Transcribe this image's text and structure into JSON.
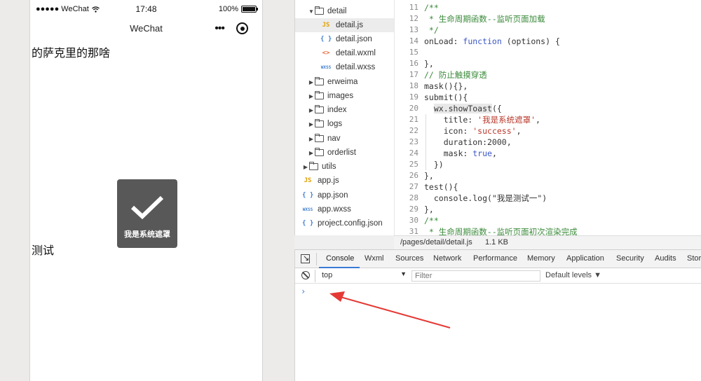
{
  "simulator": {
    "statusbar": {
      "carrier": "●●●●● WeChat",
      "time": "17:48",
      "battery": "100%",
      "battery_level": 1.0
    },
    "navbar": {
      "title": "WeChat",
      "dots": "•••"
    },
    "page": {
      "text1": "的萨克里的那啥",
      "text2": "测试"
    },
    "toast": {
      "title": "我是系统遮罩",
      "icon": "checkmark-icon"
    }
  },
  "file_tree": {
    "items": [
      {
        "label": "detail",
        "type": "folder",
        "open": true,
        "depth": 1
      },
      {
        "label": "detail.js",
        "type": "js",
        "icon_text": "JS",
        "depth": 2,
        "selected": true
      },
      {
        "label": "detail.json",
        "type": "json",
        "icon_text": "{ }",
        "depth": 2
      },
      {
        "label": "detail.wxml",
        "type": "wxml",
        "icon_text": "<>",
        "depth": 2
      },
      {
        "label": "detail.wxss",
        "type": "wxss",
        "icon_text": "WXSS",
        "depth": 2
      },
      {
        "label": "erweima",
        "type": "folder",
        "open": false,
        "depth": 1
      },
      {
        "label": "images",
        "type": "folder",
        "open": false,
        "depth": 1
      },
      {
        "label": "index",
        "type": "folder",
        "open": false,
        "depth": 1
      },
      {
        "label": "logs",
        "type": "folder",
        "open": false,
        "depth": 1
      },
      {
        "label": "nav",
        "type": "folder",
        "open": false,
        "depth": 1
      },
      {
        "label": "orderlist",
        "type": "folder",
        "open": false,
        "depth": 1
      },
      {
        "label": "utils",
        "type": "folder",
        "open": false,
        "depth": 0
      },
      {
        "label": "app.js",
        "type": "js",
        "icon_text": "JS",
        "depth": 0
      },
      {
        "label": "app.json",
        "type": "json",
        "icon_text": "{ }",
        "depth": 0
      },
      {
        "label": "app.wxss",
        "type": "wxss",
        "icon_text": "WXSS",
        "depth": 0
      },
      {
        "label": "project.config.json",
        "type": "json",
        "icon_text": "{ }",
        "depth": 0
      }
    ]
  },
  "editor": {
    "lines": [
      {
        "n": "11",
        "tokens": [
          [
            "com",
            "/**"
          ]
        ]
      },
      {
        "n": "12",
        "tokens": [
          [
            "com",
            " * 生命周期函数--监听页面加载"
          ]
        ]
      },
      {
        "n": "13",
        "tokens": [
          [
            "com",
            " */"
          ]
        ]
      },
      {
        "n": "14",
        "tokens": [
          [
            "def",
            "onLoad: "
          ],
          [
            "kw",
            "function"
          ],
          [
            "def",
            " (options) {"
          ]
        ]
      },
      {
        "n": "15",
        "tokens": [
          [
            "def",
            ""
          ]
        ]
      },
      {
        "n": "16",
        "tokens": [
          [
            "def",
            "},"
          ]
        ]
      },
      {
        "n": "17",
        "tokens": [
          [
            "com",
            "// 防止触摸穿透"
          ]
        ]
      },
      {
        "n": "18",
        "tokens": [
          [
            "def",
            "mask(){},"
          ]
        ]
      },
      {
        "n": "19",
        "tokens": [
          [
            "def",
            "submit(){"
          ]
        ]
      },
      {
        "n": "20",
        "tokens": [
          [
            "def",
            "  "
          ],
          [
            "hl",
            "wx.showToast"
          ],
          [
            "def",
            "({"
          ]
        ]
      },
      {
        "n": "21",
        "tokens": [
          [
            "def",
            "    title: "
          ],
          [
            "str",
            "'我是系统遮罩'"
          ],
          [
            "def",
            ","
          ]
        ]
      },
      {
        "n": "22",
        "tokens": [
          [
            "def",
            "    icon: "
          ],
          [
            "str",
            "'success'"
          ],
          [
            "def",
            ","
          ]
        ]
      },
      {
        "n": "23",
        "tokens": [
          [
            "def",
            "    duration:2000,"
          ]
        ]
      },
      {
        "n": "24",
        "tokens": [
          [
            "def",
            "    mask: "
          ],
          [
            "kw",
            "true"
          ],
          [
            "def",
            ","
          ]
        ]
      },
      {
        "n": "25",
        "tokens": [
          [
            "def",
            "  })"
          ]
        ]
      },
      {
        "n": "26",
        "tokens": [
          [
            "def",
            "},"
          ]
        ]
      },
      {
        "n": "27",
        "tokens": [
          [
            "def",
            "test(){"
          ]
        ]
      },
      {
        "n": "28",
        "tokens": [
          [
            "def",
            "  console.log(\"我是测试一\")"
          ]
        ]
      },
      {
        "n": "29",
        "tokens": [
          [
            "def",
            "},"
          ]
        ]
      },
      {
        "n": "30",
        "tokens": [
          [
            "com",
            "/**"
          ]
        ]
      },
      {
        "n": "31",
        "tokens": [
          [
            "com",
            " * 生命周期函数--监听页面初次渲染完成"
          ]
        ]
      }
    ]
  },
  "pathbar": {
    "path": "/pages/detail/detail.js",
    "size": "1.1 KB"
  },
  "devtools": {
    "tabs": [
      "Console",
      "Wxml",
      "Sources",
      "Network",
      "Performance",
      "Memory",
      "Application",
      "Security",
      "Audits",
      "Stora"
    ],
    "active_tab": "Console",
    "context": "top",
    "filter_placeholder": "Filter",
    "levels": "Default levels ▼",
    "prompt": "›"
  },
  "colors": {
    "accent": "#3a7bd5",
    "annotation_arrow": "#e53935",
    "toast_bg": "#585858"
  }
}
